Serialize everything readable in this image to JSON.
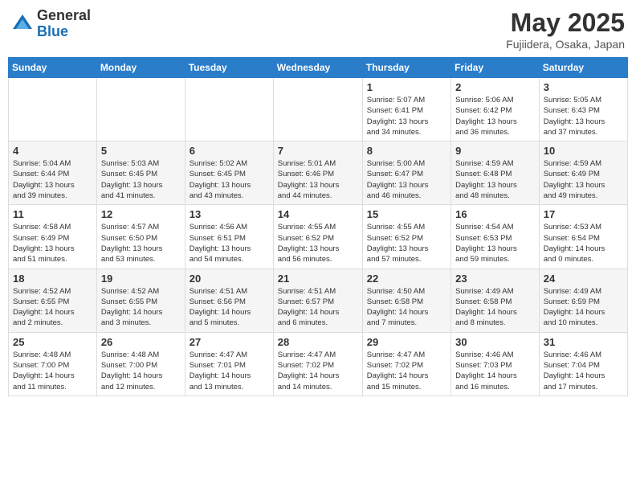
{
  "header": {
    "logo_general": "General",
    "logo_blue": "Blue",
    "title": "May 2025",
    "location": "Fujiidera, Osaka, Japan"
  },
  "weekdays": [
    "Sunday",
    "Monday",
    "Tuesday",
    "Wednesday",
    "Thursday",
    "Friday",
    "Saturday"
  ],
  "weeks": [
    [
      {
        "day": "",
        "info": ""
      },
      {
        "day": "",
        "info": ""
      },
      {
        "day": "",
        "info": ""
      },
      {
        "day": "",
        "info": ""
      },
      {
        "day": "1",
        "info": "Sunrise: 5:07 AM\nSunset: 6:41 PM\nDaylight: 13 hours\nand 34 minutes."
      },
      {
        "day": "2",
        "info": "Sunrise: 5:06 AM\nSunset: 6:42 PM\nDaylight: 13 hours\nand 36 minutes."
      },
      {
        "day": "3",
        "info": "Sunrise: 5:05 AM\nSunset: 6:43 PM\nDaylight: 13 hours\nand 37 minutes."
      }
    ],
    [
      {
        "day": "4",
        "info": "Sunrise: 5:04 AM\nSunset: 6:44 PM\nDaylight: 13 hours\nand 39 minutes."
      },
      {
        "day": "5",
        "info": "Sunrise: 5:03 AM\nSunset: 6:45 PM\nDaylight: 13 hours\nand 41 minutes."
      },
      {
        "day": "6",
        "info": "Sunrise: 5:02 AM\nSunset: 6:45 PM\nDaylight: 13 hours\nand 43 minutes."
      },
      {
        "day": "7",
        "info": "Sunrise: 5:01 AM\nSunset: 6:46 PM\nDaylight: 13 hours\nand 44 minutes."
      },
      {
        "day": "8",
        "info": "Sunrise: 5:00 AM\nSunset: 6:47 PM\nDaylight: 13 hours\nand 46 minutes."
      },
      {
        "day": "9",
        "info": "Sunrise: 4:59 AM\nSunset: 6:48 PM\nDaylight: 13 hours\nand 48 minutes."
      },
      {
        "day": "10",
        "info": "Sunrise: 4:59 AM\nSunset: 6:49 PM\nDaylight: 13 hours\nand 49 minutes."
      }
    ],
    [
      {
        "day": "11",
        "info": "Sunrise: 4:58 AM\nSunset: 6:49 PM\nDaylight: 13 hours\nand 51 minutes."
      },
      {
        "day": "12",
        "info": "Sunrise: 4:57 AM\nSunset: 6:50 PM\nDaylight: 13 hours\nand 53 minutes."
      },
      {
        "day": "13",
        "info": "Sunrise: 4:56 AM\nSunset: 6:51 PM\nDaylight: 13 hours\nand 54 minutes."
      },
      {
        "day": "14",
        "info": "Sunrise: 4:55 AM\nSunset: 6:52 PM\nDaylight: 13 hours\nand 56 minutes."
      },
      {
        "day": "15",
        "info": "Sunrise: 4:55 AM\nSunset: 6:52 PM\nDaylight: 13 hours\nand 57 minutes."
      },
      {
        "day": "16",
        "info": "Sunrise: 4:54 AM\nSunset: 6:53 PM\nDaylight: 13 hours\nand 59 minutes."
      },
      {
        "day": "17",
        "info": "Sunrise: 4:53 AM\nSunset: 6:54 PM\nDaylight: 14 hours\nand 0 minutes."
      }
    ],
    [
      {
        "day": "18",
        "info": "Sunrise: 4:52 AM\nSunset: 6:55 PM\nDaylight: 14 hours\nand 2 minutes."
      },
      {
        "day": "19",
        "info": "Sunrise: 4:52 AM\nSunset: 6:55 PM\nDaylight: 14 hours\nand 3 minutes."
      },
      {
        "day": "20",
        "info": "Sunrise: 4:51 AM\nSunset: 6:56 PM\nDaylight: 14 hours\nand 5 minutes."
      },
      {
        "day": "21",
        "info": "Sunrise: 4:51 AM\nSunset: 6:57 PM\nDaylight: 14 hours\nand 6 minutes."
      },
      {
        "day": "22",
        "info": "Sunrise: 4:50 AM\nSunset: 6:58 PM\nDaylight: 14 hours\nand 7 minutes."
      },
      {
        "day": "23",
        "info": "Sunrise: 4:49 AM\nSunset: 6:58 PM\nDaylight: 14 hours\nand 8 minutes."
      },
      {
        "day": "24",
        "info": "Sunrise: 4:49 AM\nSunset: 6:59 PM\nDaylight: 14 hours\nand 10 minutes."
      }
    ],
    [
      {
        "day": "25",
        "info": "Sunrise: 4:48 AM\nSunset: 7:00 PM\nDaylight: 14 hours\nand 11 minutes."
      },
      {
        "day": "26",
        "info": "Sunrise: 4:48 AM\nSunset: 7:00 PM\nDaylight: 14 hours\nand 12 minutes."
      },
      {
        "day": "27",
        "info": "Sunrise: 4:47 AM\nSunset: 7:01 PM\nDaylight: 14 hours\nand 13 minutes."
      },
      {
        "day": "28",
        "info": "Sunrise: 4:47 AM\nSunset: 7:02 PM\nDaylight: 14 hours\nand 14 minutes."
      },
      {
        "day": "29",
        "info": "Sunrise: 4:47 AM\nSunset: 7:02 PM\nDaylight: 14 hours\nand 15 minutes."
      },
      {
        "day": "30",
        "info": "Sunrise: 4:46 AM\nSunset: 7:03 PM\nDaylight: 14 hours\nand 16 minutes."
      },
      {
        "day": "31",
        "info": "Sunrise: 4:46 AM\nSunset: 7:04 PM\nDaylight: 14 hours\nand 17 minutes."
      }
    ]
  ]
}
